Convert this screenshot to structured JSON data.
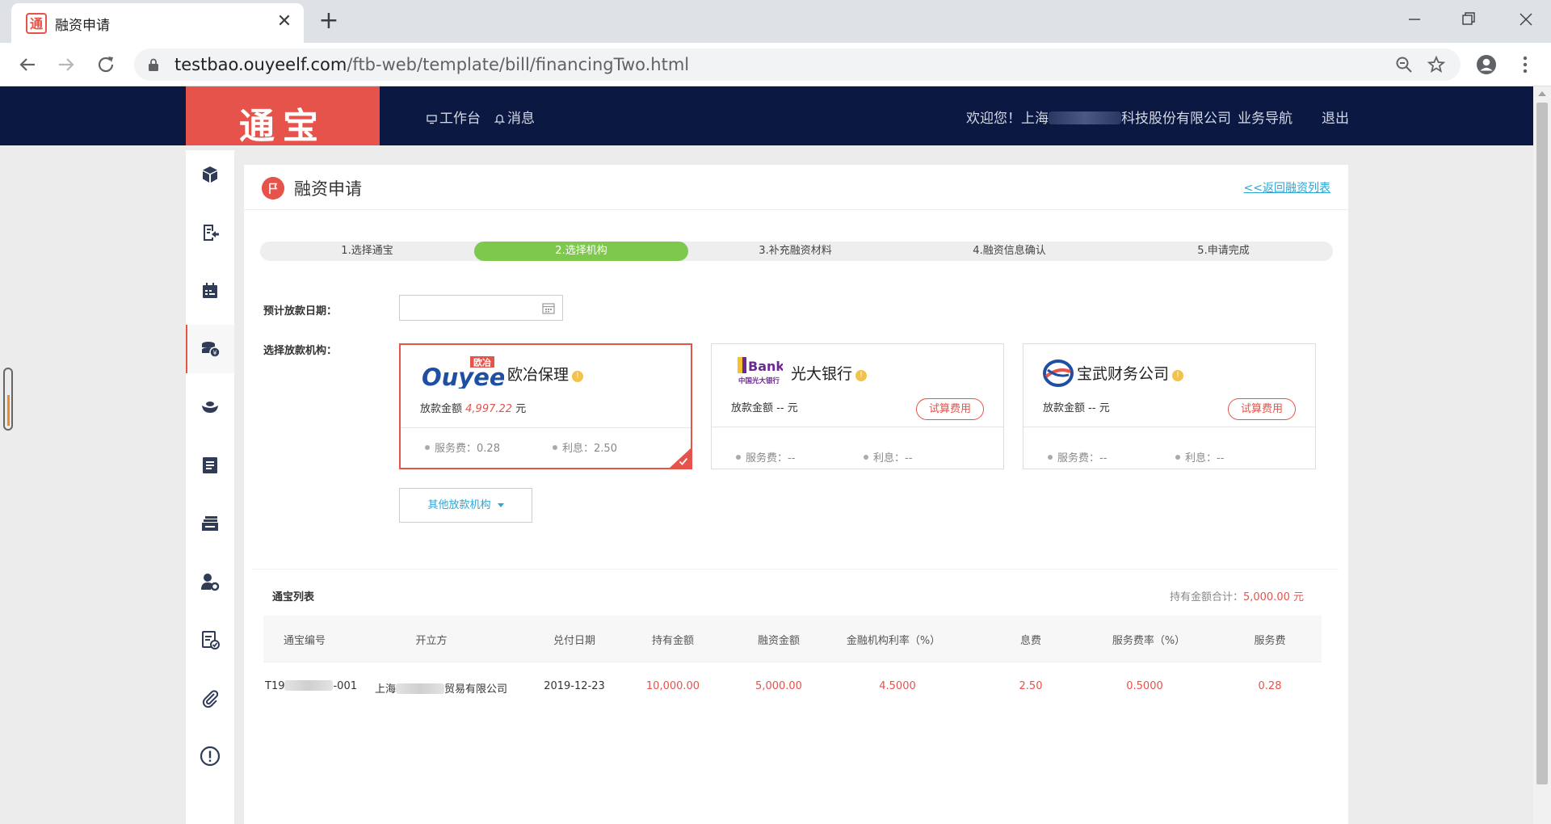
{
  "browser": {
    "tab_title": "融资申请",
    "url_host": "testbao.ouyeelf.com",
    "url_path": "/ftb-web/template/bill/financingTwo.html"
  },
  "header": {
    "logo": "通宝",
    "nav_workbench": "工作台",
    "nav_messages": "消息",
    "welcome_prefix": "欢迎您！上海",
    "welcome_suffix": "科技股份有限公司",
    "nav_business": "业务导航",
    "nav_logout": "退出"
  },
  "sidebar": {
    "items": [
      "cube-icon",
      "bill-return-icon",
      "calendar-icon",
      "coins-icon",
      "ingot-icon",
      "list-icon",
      "stack-icon",
      "user-settings-icon",
      "checklist-icon",
      "attachment-icon",
      "alert-icon"
    ],
    "active_index": 3
  },
  "page": {
    "title": "融资申请",
    "back_link": "<<返回融资列表"
  },
  "steps": [
    "1.选择通宝",
    "2.选择机构",
    "3.补充融资材料",
    "4.融资信息确认",
    "5.申请完成"
  ],
  "steps_active_index": 1,
  "form": {
    "loan_date_label": "预计放款日期：",
    "loan_date_value": "",
    "institution_label": "选择放款机构："
  },
  "institutions": [
    {
      "logo_text": "Ouyeel",
      "logo_badge": "欧冶",
      "name": "欧冶保理",
      "amount_label": "放款金额",
      "amount_value": "4,997.22",
      "amount_unit": "元",
      "fee_label": "服务费：",
      "fee_value": "0.28",
      "interest_label": "利息：",
      "interest_value": "2.50",
      "selected": true
    },
    {
      "logo_text": "Bank",
      "logo_sub": "中国光大银行",
      "name": "光大银行",
      "amount_label": "放款金额",
      "amount_value": "--",
      "amount_unit": "元",
      "calc_button": "试算费用",
      "fee_label": "服务费：",
      "fee_value": "--",
      "interest_label": "利息：",
      "interest_value": "--",
      "selected": false
    },
    {
      "name": "宝武财务公司",
      "amount_label": "放款金额",
      "amount_value": "--",
      "amount_unit": "元",
      "calc_button": "试算费用",
      "fee_label": "服务费：",
      "fee_value": "--",
      "interest_label": "利息：",
      "interest_value": "--",
      "selected": false
    }
  ],
  "other_institutions_button": "其他放款机构",
  "tongbao_list": {
    "title": "通宝列表",
    "total_label": "持有金额合计：",
    "total_value": "5,000.00 元",
    "columns": [
      "通宝编号",
      "开立方",
      "兑付日期",
      "持有金额",
      "融资金额",
      "金融机构利率（%）",
      "息费",
      "服务费率（%）",
      "服务费"
    ],
    "rows": [
      {
        "id_prefix": "T19",
        "id_suffix": "-001",
        "issuer_prefix": "上海",
        "issuer_suffix": "贸易有限公司",
        "due_date": "2019-12-23",
        "held_amount": "10,000.00",
        "financing_amount": "5,000.00",
        "institution_rate": "4.5000",
        "interest_fee": "2.50",
        "service_rate": "0.5000",
        "service_fee": "0.28"
      }
    ]
  },
  "colors": {
    "brand_red": "#e6534a",
    "header_navy": "#0b1842",
    "step_green": "#7fc84e",
    "link_blue": "#2aa7d6"
  }
}
